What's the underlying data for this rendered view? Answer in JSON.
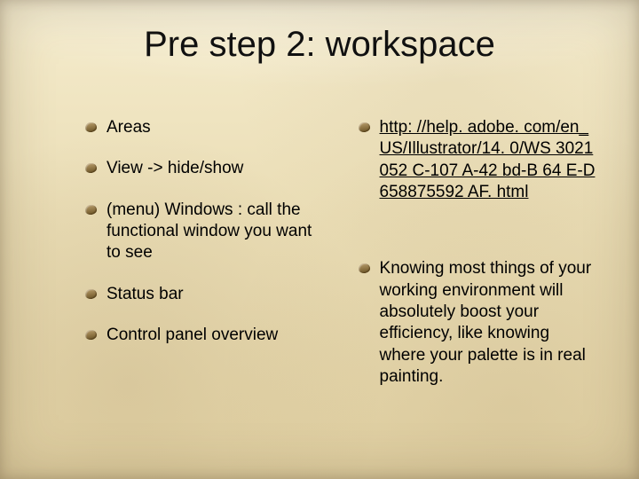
{
  "title": "Pre step 2: workspace",
  "left": {
    "items": [
      "Areas",
      "View -> hide/show",
      "(menu) Windows : call the functional window you want to see",
      "Status bar",
      "Control panel overview"
    ]
  },
  "right": {
    "link_text": "http: //help. adobe. com/en_US/Illustrator/14. 0/WS 3021052 C-107 A-42 bd-B 64 E-D 658875592 AF. html",
    "note": "Knowing most things of your working environment will absolutely boost your efficiency, like knowing where your palette is in real painting."
  }
}
